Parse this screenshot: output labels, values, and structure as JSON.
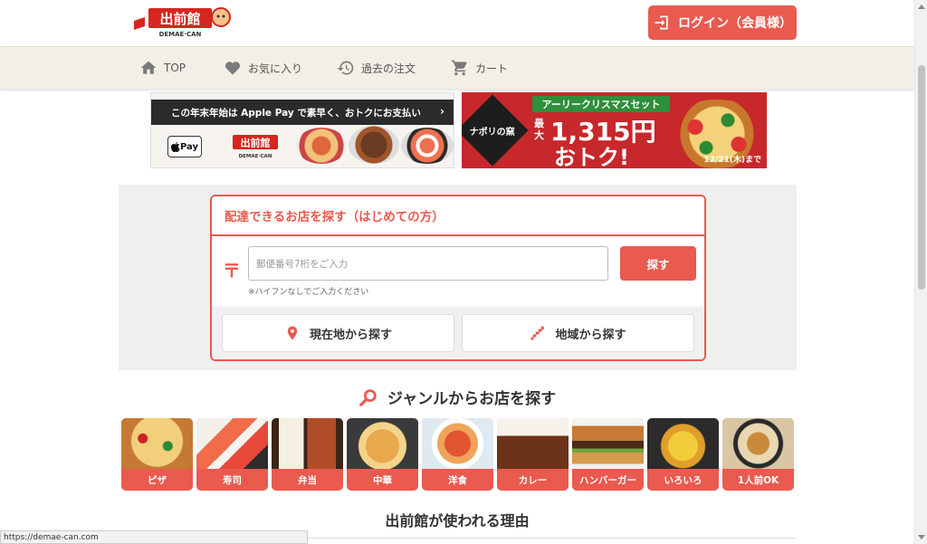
{
  "header": {
    "logo_text": "出前館",
    "logo_sub": "DEMAE-CAN",
    "login_label": "ログイン（会員様）"
  },
  "nav": {
    "items": [
      {
        "label": "TOP",
        "icon": "home-icon"
      },
      {
        "label": "お気に入り",
        "icon": "heart-icon"
      },
      {
        "label": "過去の注文",
        "icon": "history-icon"
      },
      {
        "label": "カート",
        "icon": "cart-icon"
      }
    ]
  },
  "banners": {
    "applepay": {
      "headline": "この年末年始は Apple Pay で素早く、おトクにお支払い",
      "arrow": "›",
      "pay_label": "Pay"
    },
    "christmas": {
      "tag": "アーリークリスマスセット",
      "brand": "ナポリの窯",
      "max_label": "最大",
      "amount": "1,315円",
      "otoku": "おトク!",
      "deadline": "12/21(木)まで"
    }
  },
  "search": {
    "title": "配達できるお店を探す（はじめての方）",
    "postal_mark": "〒",
    "placeholder": "郵便番号7桁をご入力",
    "button_label": "探す",
    "hint": "※ハイフンなしでご入力ください",
    "current_location_label": "現在地から探す",
    "region_label": "地域から探す"
  },
  "genres": {
    "title": "ジャンルからお店を探す",
    "items": [
      {
        "label": "ピザ"
      },
      {
        "label": "寿司"
      },
      {
        "label": "弁当"
      },
      {
        "label": "中華"
      },
      {
        "label": "洋食"
      },
      {
        "label": "カレー"
      },
      {
        "label": "ハンバーガー"
      },
      {
        "label": "いろいろ"
      },
      {
        "label": "1人前OK"
      }
    ]
  },
  "reasons": {
    "title": "出前館が使われる理由"
  },
  "status_url": "https://demae-can.com",
  "colors": {
    "accent": "#e95a4f",
    "nav_bg": "#f3eee6"
  }
}
